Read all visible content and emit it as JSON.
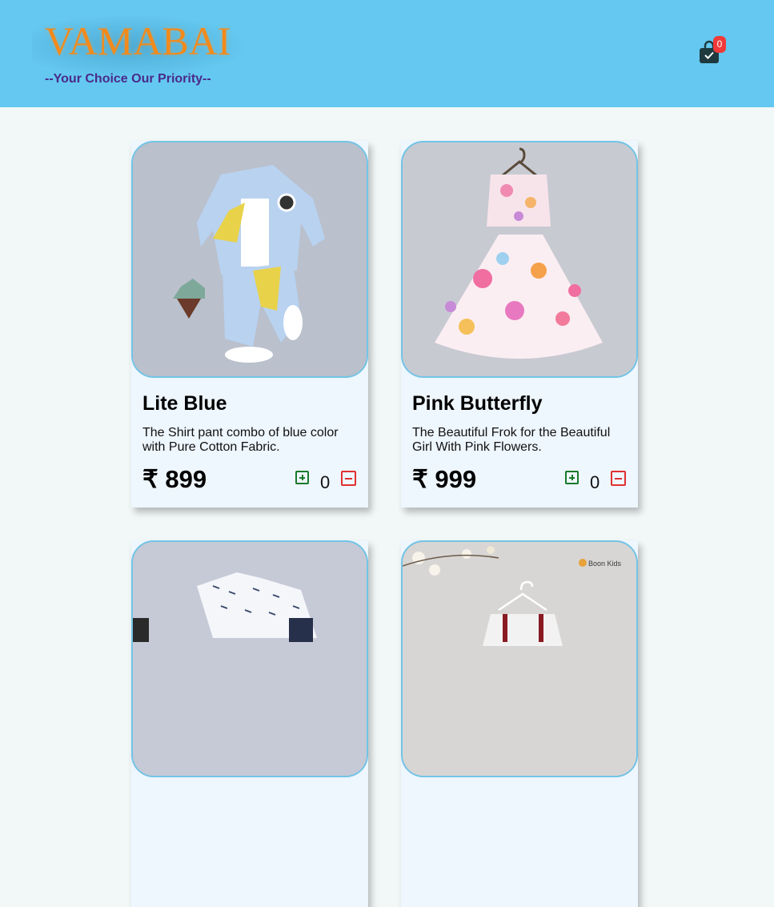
{
  "header": {
    "logo": "VAMABAI",
    "tagline": "--Your Choice Our Priority--",
    "cart_count": "0",
    "cart_icon": "shopping-bag-icon"
  },
  "products": [
    {
      "title": "Lite Blue",
      "description": "The Shirt pant combo of blue color with Pure Cotton Fabric.",
      "price": "₹ 899",
      "quantity": "0"
    },
    {
      "title": "Pink Butterfly",
      "description": "The Beautiful Frok for the Beautiful Girl With Pink Flowers.",
      "price": "₹ 999",
      "quantity": "0"
    },
    {
      "image_label": "Boon Kids"
    }
  ],
  "colors": {
    "header_bg": "#64c8f0",
    "logo": "#f28a1c",
    "tagline": "#4a2a8a",
    "badge": "#f03a3a",
    "plus": "#1a7a2a",
    "minus": "#e03030"
  }
}
